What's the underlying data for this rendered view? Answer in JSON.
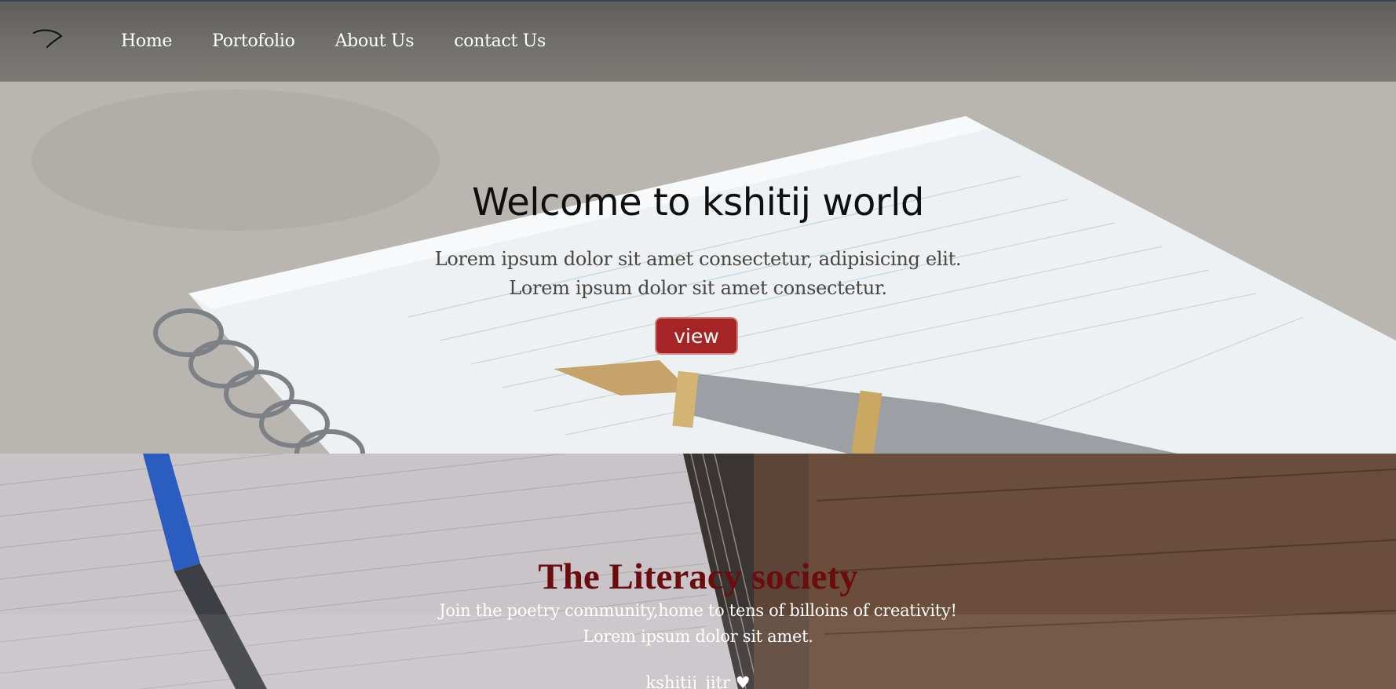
{
  "nav": {
    "logo_icon": "pen-stroke-logo-icon",
    "links": [
      {
        "label": "Home"
      },
      {
        "label": "Portofolio"
      },
      {
        "label": "About Us"
      },
      {
        "label": "contact Us"
      }
    ]
  },
  "hero": {
    "title": "Welcome to kshitij world",
    "line1": "Lorem ipsum dolor sit amet consectetur, adipisicing elit.",
    "line2": "Lorem ipsum dolor sit amet consectetur.",
    "button_label": "view",
    "button_color": "#a52527",
    "background_image": "notebook-with-fountain-pen"
  },
  "society": {
    "title": "The Literacy society",
    "title_color": "#6b0d0e",
    "line1": "Join the poetry community,home to tens of billoins of creativity!",
    "line2": "Lorem ipsum dolor sit amet.",
    "signature": "kshitij_jitr ♥",
    "background_image": "notebook-pen-on-wooden-table"
  }
}
